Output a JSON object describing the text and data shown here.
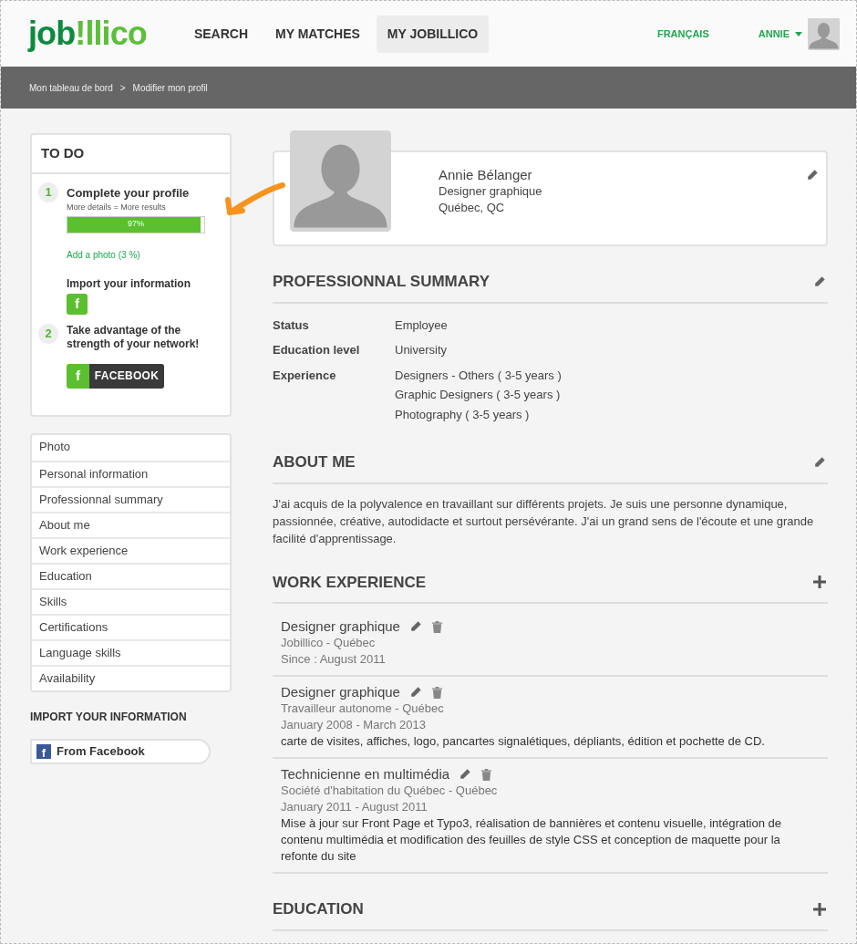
{
  "header": {
    "logo": [
      {
        "text": "job",
        "color": "#0c8a3e"
      },
      {
        "text": "!llico",
        "color": "#5cbf3a"
      }
    ],
    "nav": [
      {
        "label": "SEARCH",
        "selected": false
      },
      {
        "label": "MY MATCHES",
        "selected": false
      },
      {
        "label": "MY JOBILLICO",
        "selected": true
      }
    ],
    "language": "FRANÇAIS",
    "user": "ANNIE"
  },
  "breadcrumb": [
    "Mon tableau de bord",
    ">",
    "Modifier mon profil"
  ],
  "todo": {
    "title": "TO DO",
    "step1": {
      "number": "1",
      "title": "Complete your profile",
      "subtitle": "More details = More results",
      "progress": {
        "level": 0.97,
        "label": "97%"
      },
      "link": "Add a photo (3 %)",
      "import_title": "Import your information",
      "import_icon": "f"
    },
    "step2": {
      "number": "2",
      "title": "Take advantage of the strength of your network!",
      "button_icon": "f",
      "button_label": "FACEBOOK"
    }
  },
  "sidebar": {
    "items": [
      "Photo",
      "Personal information",
      "Professionnal summary",
      "About me",
      "Work experience",
      "Education",
      "Skills",
      "Certifications",
      "Language skills",
      "Availability"
    ],
    "import_title": "IMPORT YOUR INFORMATION",
    "import_icon": "f",
    "import_button": "From Facebook"
  },
  "profile": {
    "name": "Annie Bélanger",
    "title": "Designer graphique",
    "location": "Québec, QC"
  },
  "sections": [
    {
      "kind": "summary",
      "title": "PROFESSIONNAL SUMMARY",
      "editable": true,
      "addable": false,
      "rows": [
        {
          "label": "Status",
          "values": [
            "Employee"
          ]
        },
        {
          "label": "Education level",
          "values": [
            "University"
          ]
        },
        {
          "label": "Experience",
          "values": [
            "Designers - Others ( 3-5 years )",
            "Graphic Designers ( 3-5 years )",
            "Photography ( 3-5 years )"
          ]
        }
      ]
    },
    {
      "kind": "text",
      "title": "ABOUT ME",
      "editable": true,
      "addable": false,
      "text": "J'ai acquis de la polyvalence en travaillant sur différents projets. Je suis une personne dynamique, passionnée, créative, autodidacte et surtout persévérante. J'ai un grand sens de l'écoute et une grande facilité d'apprentissage."
    },
    {
      "kind": "jobs",
      "title": "WORK EXPERIENCE",
      "editable": false,
      "addable": true,
      "entries": [
        {
          "title": "Designer graphique",
          "company": "Jobillico - Québec",
          "dates": "Since : August 2011"
        },
        {
          "title": "Designer graphique",
          "company": "Travailleur autonome - Québec",
          "dates": "January 2008 - March 2013",
          "description": "carte de visites, affiches, logo, pancartes signalétiques, dépliants, édition et pochette de CD."
        },
        {
          "title": "Technicienne en multimédia",
          "company": "Société d'habitation du Québec - Québec",
          "dates": "January 2011 - August 2011",
          "description": "Mise à jour sur Front Page et Typo3, réalisation de bannières et contenu visuelle, intégration de contenu multimédia et modification des feuilles de style CSS et conception de maquette pour la refonte du site"
        }
      ]
    },
    {
      "kind": "heading",
      "title": "EDUCATION",
      "editable": false,
      "addable": true
    }
  ]
}
